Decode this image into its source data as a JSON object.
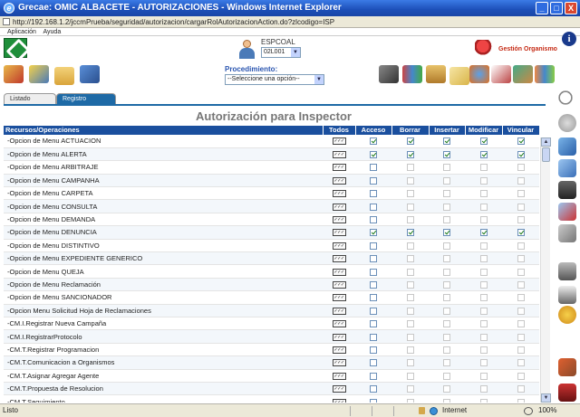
{
  "window": {
    "title": "Grecae: OMIC ALBACETE - AUTORIZACIONES - Windows Internet Explorer",
    "address": "http://192.168.1.2/jccmPrueba/seguridad/autorizacion/cargarRolAutorizacionAction.do?zlcodigo=ISP",
    "buttons": {
      "minimize": "_",
      "maximize": "□",
      "close": "X"
    }
  },
  "menu": {
    "items": [
      "Aplicación",
      "Ayuda"
    ]
  },
  "user": {
    "name": "ESPCOAL",
    "selected": "02L001"
  },
  "gestion": {
    "label": "Gestión Organismo"
  },
  "procedimiento": {
    "label": "Procedimiento:",
    "selected": "--Seleccione una opción--"
  },
  "tabs": {
    "listado": "Listado",
    "registro": "Registro"
  },
  "page_title": "Autorización para Inspector",
  "table": {
    "headers": [
      "Recursos/Operaciones",
      "Todos",
      "Acceso",
      "Borrar",
      "Insertar",
      "Modificar",
      "Vincular"
    ],
    "todos_label": "✓✓✓",
    "rows": [
      {
        "label": "-Opcion de Menu ACTUACION",
        "checks": [
          1,
          1,
          1,
          1,
          1
        ],
        "enabled": [
          1,
          1,
          1,
          1,
          1
        ]
      },
      {
        "label": "-Opcion de Menu ALERTA",
        "checks": [
          1,
          1,
          1,
          1,
          1
        ],
        "enabled": [
          1,
          1,
          1,
          1,
          1
        ]
      },
      {
        "label": "-Opcion de Menu ARBITRAJE",
        "checks": [
          0,
          0,
          0,
          0,
          0
        ],
        "enabled": [
          1,
          0,
          0,
          0,
          0
        ]
      },
      {
        "label": "-Opcion de Menu CAMPANHA",
        "checks": [
          0,
          0,
          0,
          0,
          0
        ],
        "enabled": [
          1,
          0,
          0,
          0,
          0
        ]
      },
      {
        "label": "-Opcion de Menu CARPETA",
        "checks": [
          0,
          0,
          0,
          0,
          0
        ],
        "enabled": [
          1,
          0,
          0,
          0,
          0
        ]
      },
      {
        "label": "-Opcion de Menu CONSULTA",
        "checks": [
          0,
          0,
          0,
          0,
          0
        ],
        "enabled": [
          1,
          0,
          0,
          0,
          0
        ]
      },
      {
        "label": "-Opcion de Menu DEMANDA",
        "checks": [
          0,
          0,
          0,
          0,
          0
        ],
        "enabled": [
          1,
          0,
          0,
          0,
          0
        ]
      },
      {
        "label": "-Opcion de Menu DENUNCIA",
        "checks": [
          1,
          1,
          1,
          1,
          1
        ],
        "enabled": [
          1,
          1,
          1,
          1,
          1
        ]
      },
      {
        "label": "-Opcion de Menu DISTINTIVO",
        "checks": [
          0,
          0,
          0,
          0,
          0
        ],
        "enabled": [
          1,
          0,
          0,
          0,
          0
        ]
      },
      {
        "label": "-Opcion de Menu EXPEDIENTE GENERICO",
        "checks": [
          0,
          0,
          0,
          0,
          0
        ],
        "enabled": [
          1,
          0,
          0,
          0,
          0
        ]
      },
      {
        "label": "-Opcion de Menu QUEJA",
        "checks": [
          0,
          0,
          0,
          0,
          0
        ],
        "enabled": [
          1,
          0,
          0,
          0,
          0
        ]
      },
      {
        "label": "-Opcion de Menu Reclamación",
        "checks": [
          0,
          0,
          0,
          0,
          0
        ],
        "enabled": [
          1,
          0,
          0,
          0,
          0
        ]
      },
      {
        "label": "-Opcion de Menu SANCIONADOR",
        "checks": [
          0,
          0,
          0,
          0,
          0
        ],
        "enabled": [
          1,
          0,
          0,
          0,
          0
        ]
      },
      {
        "label": "-Opcion Menu Solicitud Hoja de Reclamaciones",
        "checks": [
          0,
          0,
          0,
          0,
          0
        ],
        "enabled": [
          1,
          0,
          0,
          0,
          0
        ]
      },
      {
        "label": "-CM.I.Registrar Nueva Campaña",
        "checks": [
          0,
          0,
          0,
          0,
          0
        ],
        "enabled": [
          1,
          0,
          0,
          0,
          0
        ]
      },
      {
        "label": "-CM.I.RegistrarProtocolo",
        "checks": [
          0,
          0,
          0,
          0,
          0
        ],
        "enabled": [
          1,
          0,
          0,
          0,
          0
        ]
      },
      {
        "label": "-CM.T.Registrar Programacion",
        "checks": [
          0,
          0,
          0,
          0,
          0
        ],
        "enabled": [
          1,
          0,
          0,
          0,
          0
        ]
      },
      {
        "label": "-CM.T.Comunicacion a Organismos",
        "checks": [
          0,
          0,
          0,
          0,
          0
        ],
        "enabled": [
          1,
          0,
          0,
          0,
          0
        ]
      },
      {
        "label": "-CM.T.Asignar Agregar Agente",
        "checks": [
          0,
          0,
          0,
          0,
          0
        ],
        "enabled": [
          1,
          0,
          0,
          0,
          0
        ]
      },
      {
        "label": "-CM.T.Propuesta de Resolucion",
        "checks": [
          0,
          0,
          0,
          0,
          0
        ],
        "enabled": [
          1,
          0,
          0,
          0,
          0
        ]
      },
      {
        "label": "-CM.T.Seguimiento",
        "checks": [
          0,
          0,
          0,
          0,
          0
        ],
        "enabled": [
          1,
          0,
          0,
          0,
          0
        ]
      }
    ]
  },
  "toolbar_icons": [
    "puzzle-icon",
    "people-icon",
    "folder-icon",
    "printer-icon"
  ],
  "toolbar_icons_right": [
    "laptop-icon",
    "books-icon",
    "cabinet-icon",
    "envelope-icon",
    "globe-icon",
    "search-doc-icon",
    "tools-icon",
    "chart-icon"
  ],
  "right_icons": [
    "magnifier-icon",
    "back-icon",
    "layers-icon",
    "stack-icon",
    "save-icon",
    "delete-icon",
    "clip-icon",
    "trash-icon",
    "print-icon",
    "settings-icon",
    "tools-icon",
    "car-icon"
  ],
  "statusbar": {
    "text": "Listo",
    "zone": "Internet",
    "zoom": "100%"
  },
  "colors": {
    "header_blue": "#1a4f9e",
    "title_grey": "#777777",
    "tab_blue": "#1e6aa6"
  }
}
